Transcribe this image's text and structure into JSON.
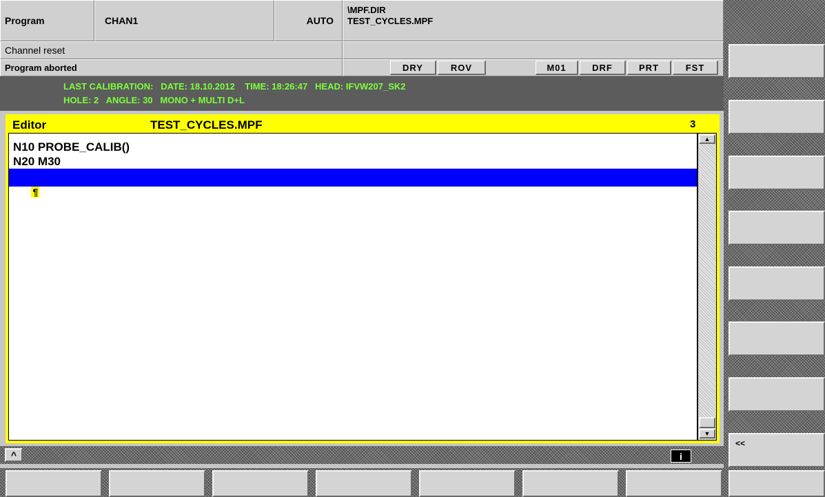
{
  "header": {
    "area": "Program",
    "channel": "CHAN1",
    "mode": "AUTO",
    "path_dir": "\\MPF.DIR",
    "path_file": "TEST_CYCLES.MPF",
    "channel_state": "Channel reset",
    "program_state": "Program aborted"
  },
  "flags": {
    "dry": "DRY",
    "rov": "ROV",
    "m01": "M01",
    "drf": "DRF",
    "prt": "PRT",
    "fst": "FST"
  },
  "message": {
    "line1": "LAST CALIBRATION:   DATE: 18.10.2012    TIME: 18:26:47   HEAD: IFVW207_SK2",
    "line2": "HOLE: 2   ANGLE: 30   MONO + MULTI D+L"
  },
  "editor": {
    "title": "Editor",
    "filename": "TEST_CYCLES.MPF",
    "count": "3",
    "lines": [
      "N10 PROBE_CALIB()",
      "N20 M30"
    ],
    "cursor_glyph": "¶"
  },
  "status": {
    "recall": "^",
    "info": "i"
  },
  "vertical_softkeys": {
    "back_label": "<<"
  },
  "colors": {
    "message_text": "#7dff3a",
    "message_bg": "#5c5c5c",
    "editor_frame": "#ffff00",
    "cursor_line": "#0000ff"
  }
}
